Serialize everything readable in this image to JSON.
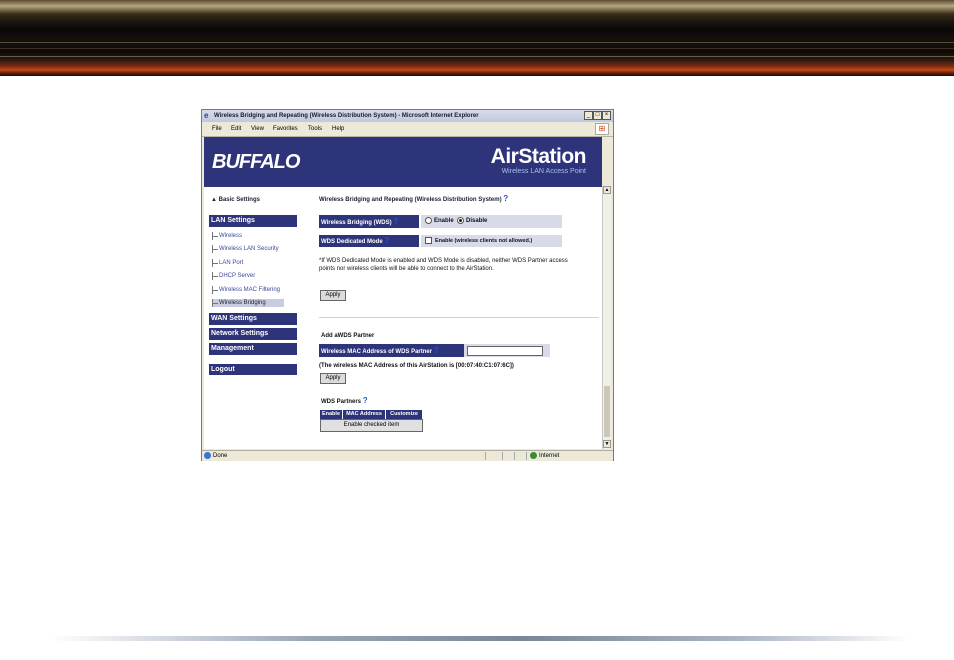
{
  "window": {
    "title": "Wireless Bridging and Repeating (Wireless Distribution System) - Microsoft Internet Explorer",
    "minimize": "_",
    "maximize": "□",
    "close": "×"
  },
  "menu": [
    "File",
    "Edit",
    "View",
    "Favorites",
    "Tools",
    "Help"
  ],
  "header": {
    "brand": "BUFFALO",
    "product": "AirStation",
    "product_sub": "Wireless LAN Access Point"
  },
  "sidebar": {
    "basic": "Basic Settings",
    "lan_settings": "LAN Settings",
    "lan_items": [
      "Wireless",
      "Wireless LAN Security",
      "LAN Port",
      "DHCP Server",
      "Wireless MAC Filtering",
      "Wireless Bridging"
    ],
    "active_item": "Wireless Bridging",
    "wan_settings": "WAN Settings",
    "network_settings": "Network Settings",
    "management": "Management",
    "logout": "Logout"
  },
  "main": {
    "title": "Wireless Bridging and Repeating (Wireless Distribution System)",
    "help": "?",
    "wds_label": "Wireless Bridging (WDS)",
    "enable_label": "Enable",
    "disable_label": "Disable",
    "wds_selected": "Disable",
    "dedicated_label": "WDS Dedicated Mode",
    "dedicated_option": "Enable (wireless clients not allowed.)",
    "dedicated_checked": false,
    "note": "*If WDS Dedicated Mode is enabled and WDS Mode is disabled, neither WDS Partner access points nor wireless clients will be able to connect to the AirStation.",
    "apply": "Apply",
    "add_partner_title": "Add aWDS Partner",
    "mac_label": "Wireless MAC Address of WDS Partner",
    "mac_value": "",
    "mac_note": "(The wireless MAC Address of this AirStation is [00:07:40:C1:07:6C])",
    "apply2": "Apply",
    "partners_title": "WDS Partners",
    "table_headers": [
      "Enable",
      "MAC Address",
      "Customize"
    ],
    "enable_checked_button": "Enable checked item"
  },
  "status": {
    "text": "Done",
    "zone": "Internet"
  }
}
